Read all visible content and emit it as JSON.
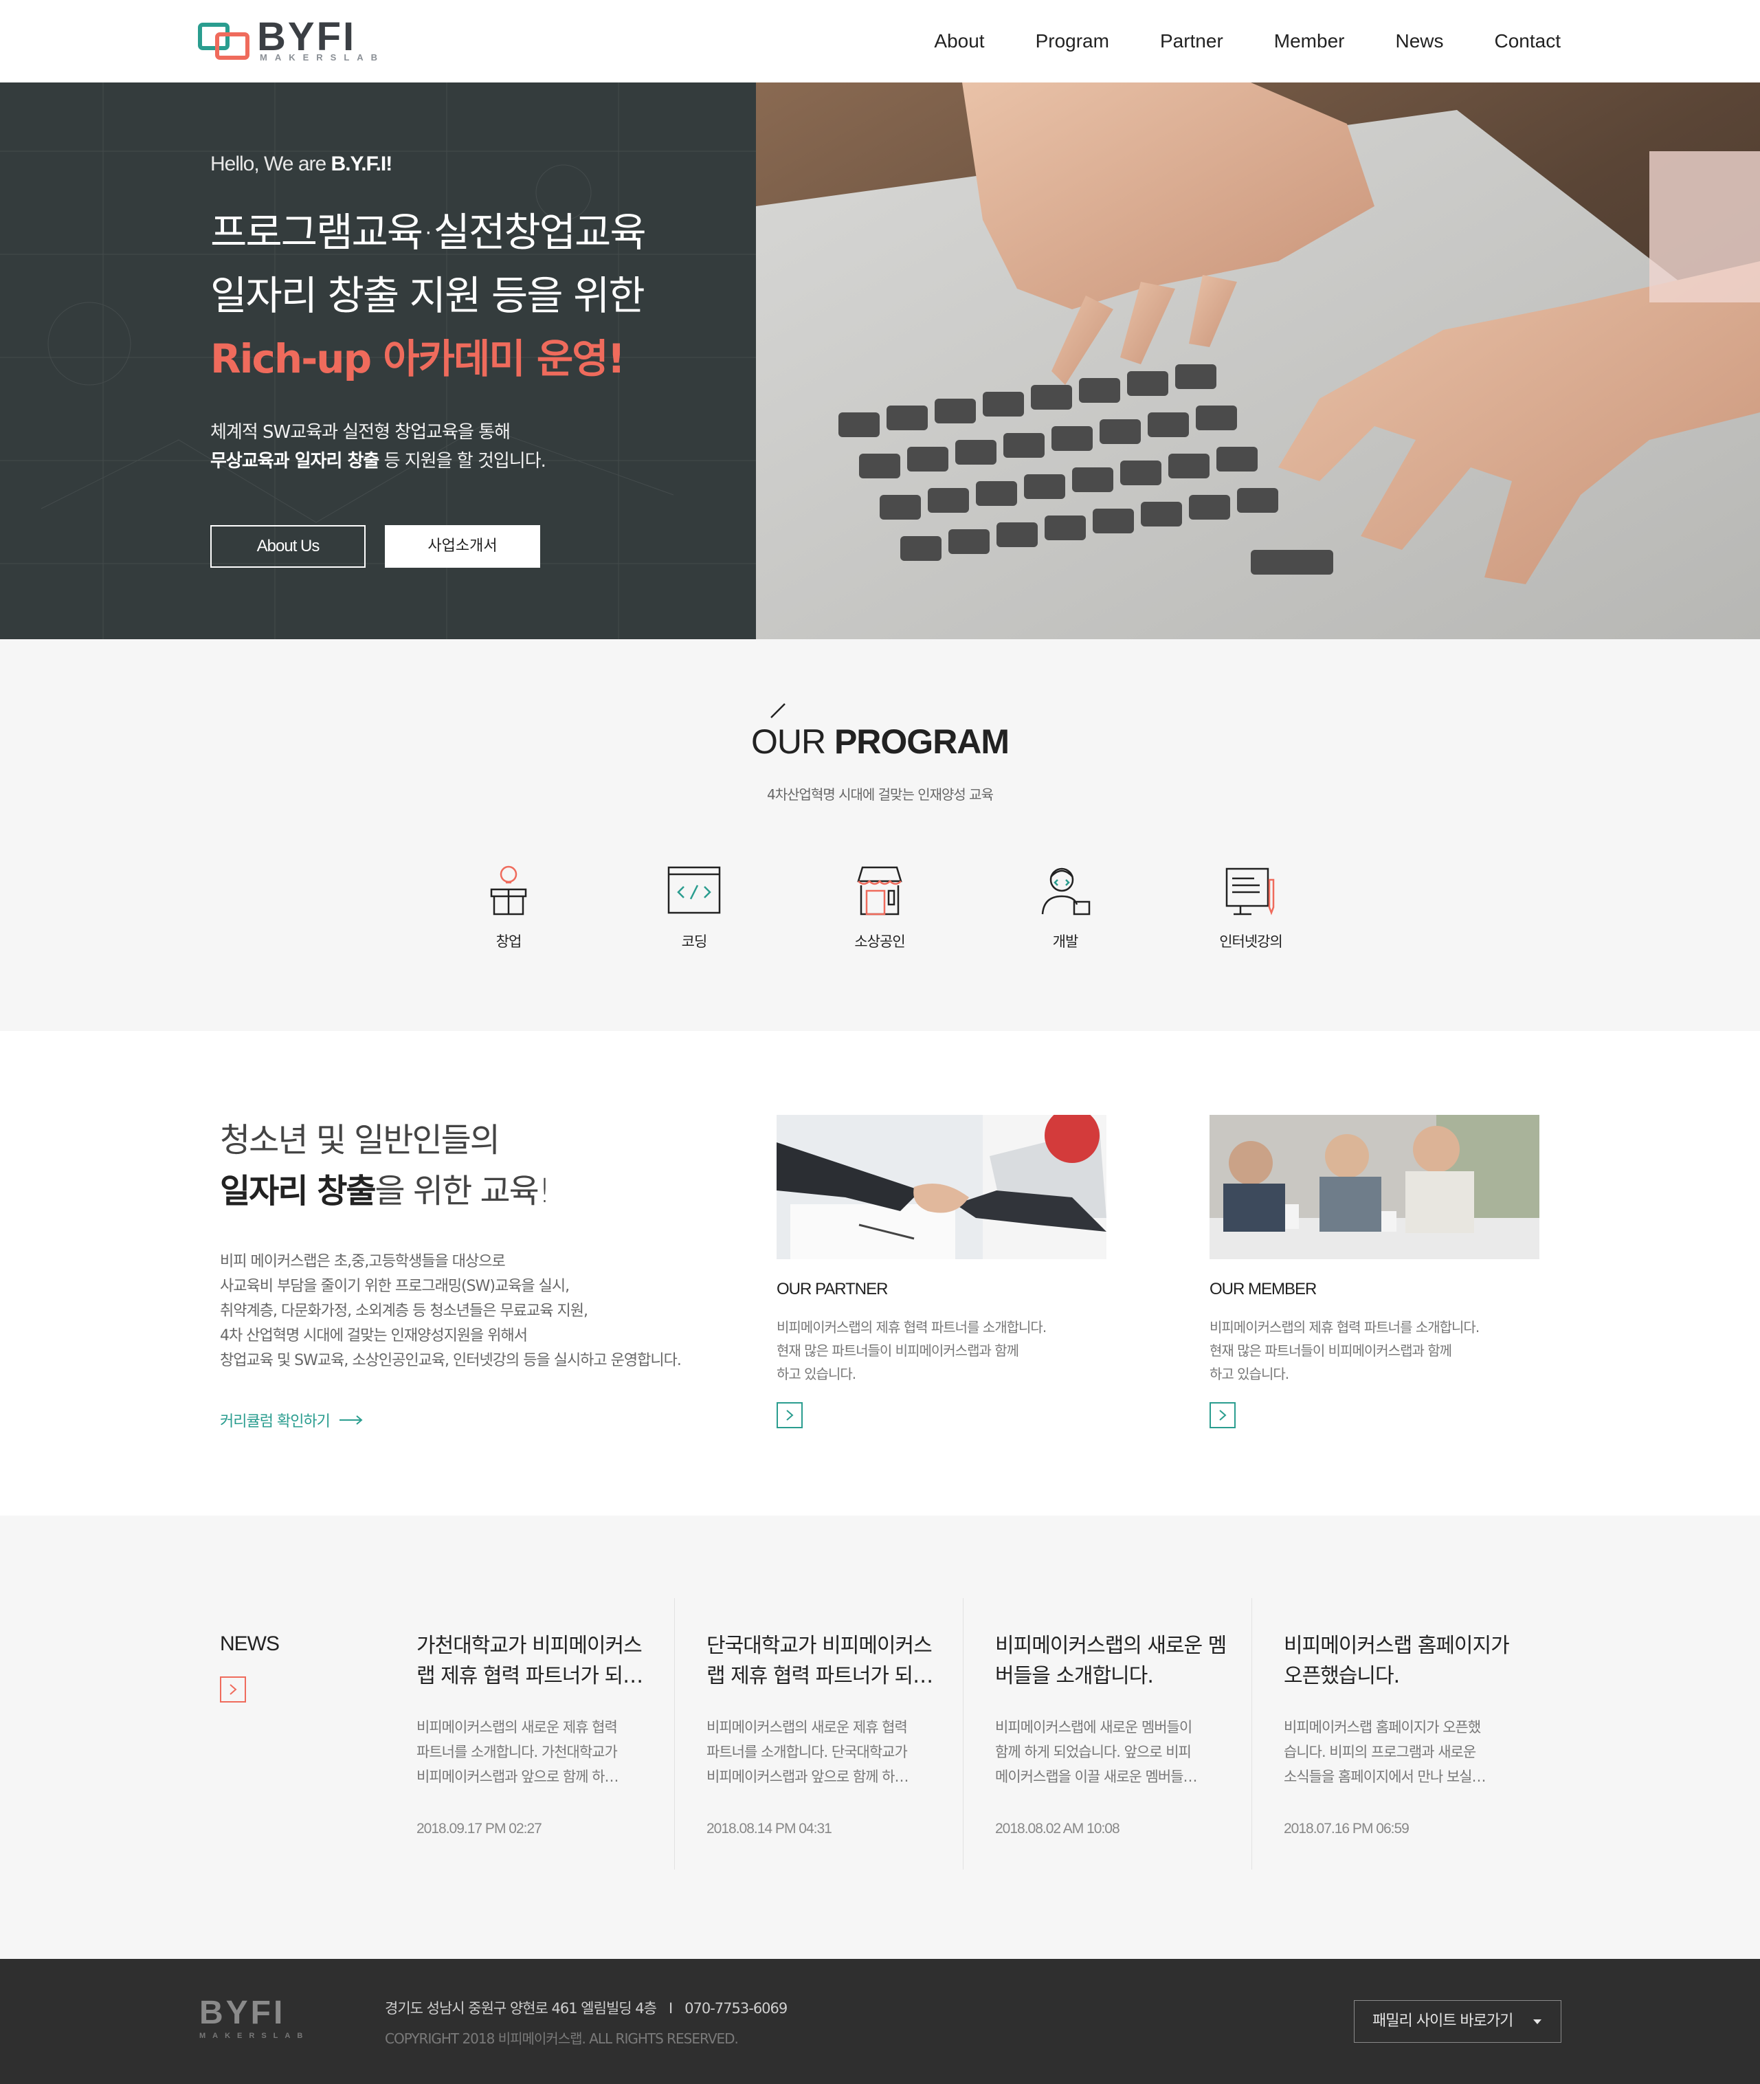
{
  "header": {
    "logo_text": "BYFI",
    "logo_sub": "MAKERSLAB",
    "nav": [
      "About",
      "Program",
      "Partner",
      "Member",
      "News",
      "Contact"
    ]
  },
  "hero": {
    "hello_prefix": "Hello, We are ",
    "hello_brand": "B.Y.F.I!",
    "title_line1": "프로그램교육·실전창업교육",
    "title_line2": "일자리 창출 지원 등을 위한",
    "title_line3": "Rich-up 아카데미 운영!",
    "desc_line1": "체계적 SW교육과 실전형 창업교육을 통해",
    "desc_line2_bold": "무상교육과 일자리 창출",
    "desc_line2_rest": " 등 지원을 할 것입니다.",
    "btn_about": "About Us",
    "btn_brochure": "사업소개서"
  },
  "program": {
    "title_light": "OUR",
    "title_bold": "PROGRAM",
    "subtitle": "4차산업혁명 시대에 걸맞는 인재양성 교육",
    "items": [
      {
        "label": "창업",
        "icon": "startup-icon"
      },
      {
        "label": "코딩",
        "icon": "coding-icon"
      },
      {
        "label": "소상공인",
        "icon": "shop-icon"
      },
      {
        "label": "개발",
        "icon": "developer-icon"
      },
      {
        "label": "인터넷강의",
        "icon": "online-lecture-icon"
      }
    ]
  },
  "intro": {
    "title_line1": "청소년 및 일반인들의",
    "title_bold": "일자리 창출",
    "title_rest": "을 위한 교육!",
    "body": [
      "비피 메이커스랩은 초,중,고등학생들을 대상으로",
      "사교육비 부담을 줄이기 위한 프로그래밍(SW)교육을 실시,",
      "취약계층, 다문화가정, 소외계층 등 청소년들은 무료교육 지원,",
      "4차 산업혁명 시대에 걸맞는 인재양성지원을 위해서",
      "창업교육 및 SW교육, 소상인공인교육, 인터넷강의 등을 실시하고 운영합니다."
    ],
    "link_label": "커리큘럼 확인하기",
    "partner": {
      "title": "OUR PARTNER",
      "desc": [
        "비피메이커스랩의 제휴 협력 파트너를 소개합니다.",
        "현재 많은 파트너들이 비피메이커스랩과 함께",
        "하고 있습니다."
      ]
    },
    "member": {
      "title": "OUR MEMBER",
      "desc": [
        "비피메이커스랩의 제휴 협력 파트너를 소개합니다.",
        "현재 많은 파트너들이 비피메이커스랩과 함께",
        "하고 있습니다."
      ]
    }
  },
  "news": {
    "title": "NEWS",
    "items": [
      {
        "head": [
          "가천대학교가 비피메이커스",
          "랩 제휴 협력 파트너가 되…"
        ],
        "body": [
          "비피메이커스랩의 새로운 제휴 협력",
          "파트너를 소개합니다. 가천대학교가",
          "비피메이커스랩과 앞으로 함께 하…"
        ],
        "date": "2018.09.17 PM 02:27"
      },
      {
        "head": [
          "단국대학교가 비피메이커스",
          "랩 제휴 협력 파트너가 되…"
        ],
        "body": [
          "비피메이커스랩의 새로운 제휴 협력",
          "파트너를 소개합니다. 단국대학교가",
          "비피메이커스랩과 앞으로 함께 하…"
        ],
        "date": "2018.08.14 PM 04:31"
      },
      {
        "head": [
          "비피메이커스랩의 새로운 멤",
          "버들을 소개합니다."
        ],
        "body": [
          "비피메이커스랩에 새로운 멤버들이",
          "함께 하게 되었습니다. 앞으로 비피",
          "메이커스랩을 이끌 새로운 멤버들…"
        ],
        "date": "2018.08.02 AM 10:08"
      },
      {
        "head": [
          "비피메이커스랩 홈페이지가",
          "오픈했습니다."
        ],
        "body": [
          "비피메이커스랩 홈페이지가 오픈했",
          "습니다. 비피의 프로그램과 새로운",
          "소식들을 홈페이지에서 만나 보실…"
        ],
        "date": "2018.07.16 PM 06:59"
      }
    ]
  },
  "footer": {
    "logo_text": "BYFI",
    "logo_sub": "MAKERSLAB",
    "address": "경기도 성남시 중원구 양현로 461 엘림빌딩 4층",
    "separator": "I",
    "phone": "070-7753-6069",
    "copyright": "COPYRIGHT 2018 비피메이커스랩. ALL RIGHTS RESERVED.",
    "family_site": "패밀리 사이트 바로가기"
  },
  "colors": {
    "accent_red": "#ef6b5c",
    "accent_teal": "#2a9d8f",
    "hero_bg": "#343c3d",
    "footer_bg": "#2f2f2f"
  }
}
